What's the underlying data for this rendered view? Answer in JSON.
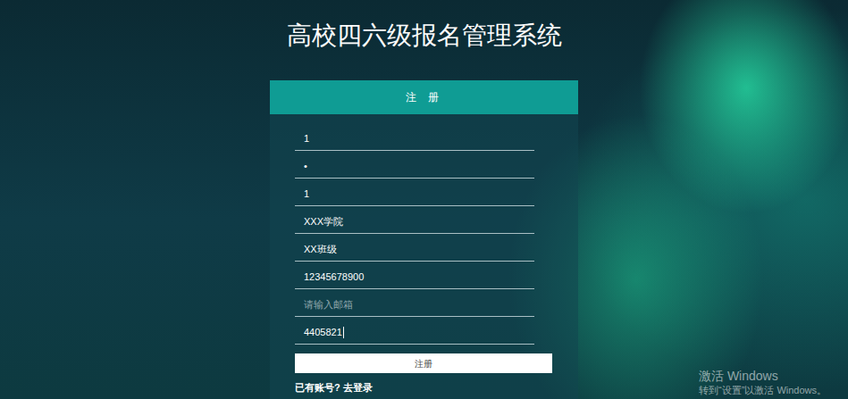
{
  "title": "高校四六级报名管理系统",
  "form": {
    "header": "注 册",
    "fields": [
      {
        "value": "1",
        "placeholder": "",
        "focused": false
      },
      {
        "value": "•",
        "placeholder": "",
        "focused": false
      },
      {
        "value": "1",
        "placeholder": "",
        "focused": false
      },
      {
        "value": "XXX学院",
        "placeholder": "",
        "focused": false
      },
      {
        "value": "XX班级",
        "placeholder": "",
        "focused": false
      },
      {
        "value": "12345678900",
        "placeholder": "",
        "focused": false
      },
      {
        "value": "",
        "placeholder": "请输入邮箱",
        "focused": false
      },
      {
        "value": "4405821",
        "placeholder": "",
        "focused": true
      }
    ],
    "submit": "注册",
    "login_link": "已有账号? 去登录"
  },
  "watermark": {
    "title": "激活 Windows",
    "subtitle": "转到“设置”以激活 Windows。"
  }
}
